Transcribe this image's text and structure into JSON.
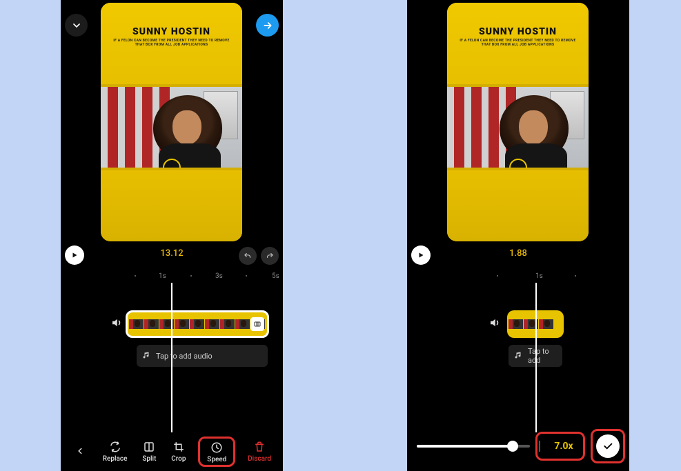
{
  "left": {
    "thumb": {
      "title": "SUNNY HOSTIN",
      "subtitle": "IF A FELON CAN BECOME THE PRESIDENT THEY NEED TO REMOVE THAT BOX FROM ALL JOB APPLICATIONS"
    },
    "time": "13.12",
    "ruler": {
      "t1": "1s",
      "t3": "3s",
      "t5": "5s"
    },
    "audio_label": "Tap to add audio",
    "toolbar": {
      "replace": "Replace",
      "split": "Split",
      "crop": "Crop",
      "speed": "Speed",
      "discard": "Discard"
    }
  },
  "right": {
    "thumb": {
      "title": "SUNNY HOSTIN",
      "subtitle": "IF A FELON CAN BECOME THE PRESIDENT THEY NEED TO REMOVE THAT BOX FROM ALL JOB APPLICATIONS"
    },
    "time": "1.88",
    "ruler": {
      "t1": "1s"
    },
    "audio_label": "Tap to add",
    "speed_value": "7.0x"
  }
}
